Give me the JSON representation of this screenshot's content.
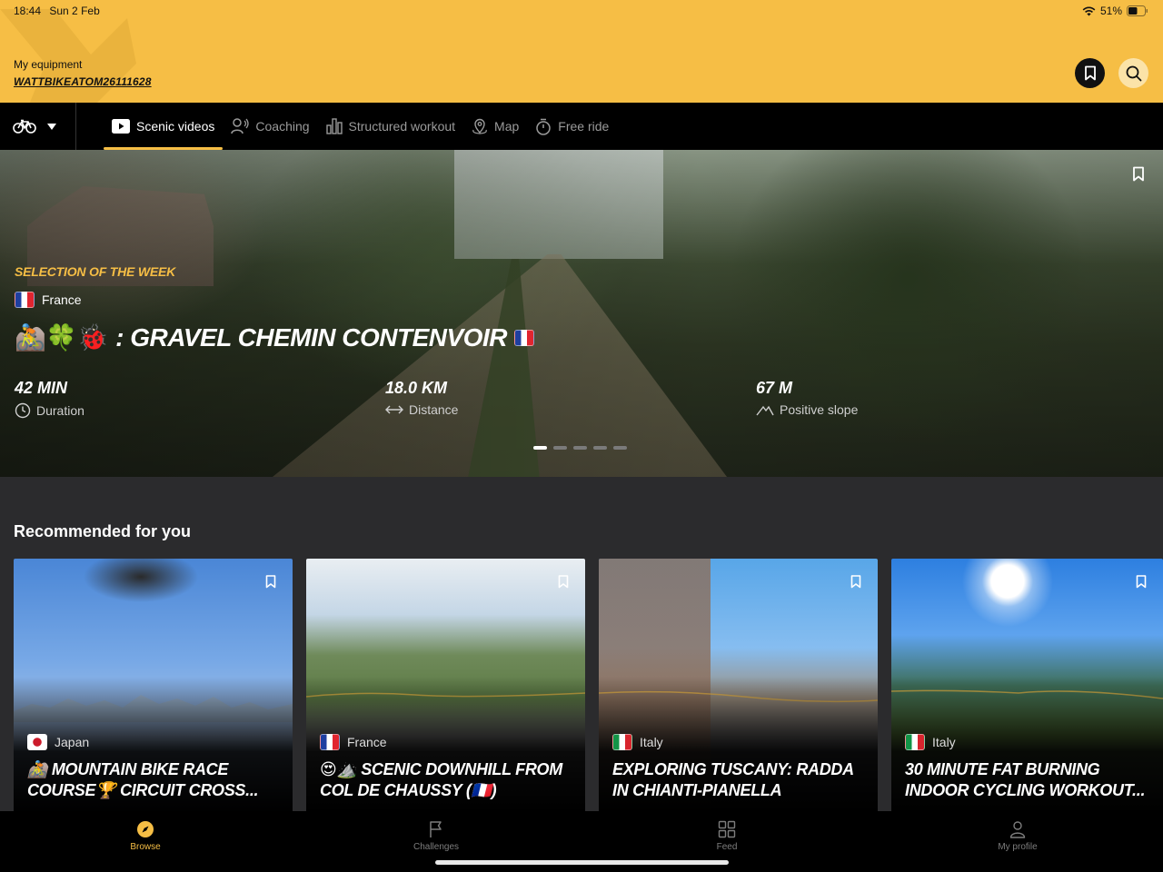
{
  "status_bar": {
    "time": "18:44",
    "date": "Sun 2 Feb",
    "battery": "51%"
  },
  "header": {
    "equipment_label": "My equipment",
    "equipment_value": "WATTBIKEATOM26111628",
    "accent_color": "#f6be45"
  },
  "tabs": [
    {
      "label": "Scenic videos",
      "icon": "play-icon",
      "active": true
    },
    {
      "label": "Coaching",
      "icon": "coach-icon",
      "active": false
    },
    {
      "label": "Structured workout",
      "icon": "bar-chart-icon",
      "active": false
    },
    {
      "label": "Map",
      "icon": "map-pin-icon",
      "active": false
    },
    {
      "label": "Free ride",
      "icon": "stopwatch-icon",
      "active": false
    }
  ],
  "hero": {
    "badge": "SELECTION OF THE WEEK",
    "country": "France",
    "title_emoji": "🚵🍀🐞",
    "title": ": GRAVEL CHEMIN CONTENVOIR",
    "stats": [
      {
        "value": "42 MIN",
        "label": "Duration",
        "icon": "clock-icon"
      },
      {
        "value": "18.0 KM",
        "label": "Distance",
        "icon": "arrows-horizontal-icon"
      },
      {
        "value": "67 M",
        "label": "Positive slope",
        "icon": "mountain-icon"
      }
    ],
    "carousel_active_index": 0,
    "carousel_count": 5
  },
  "recommended": {
    "title": "Recommended for you",
    "cards": [
      {
        "country": "Japan",
        "title": "🚵 MOUNTAIN BIKE RACE COURSE🏆 CIRCUIT CROSS..."
      },
      {
        "country": "France",
        "title": "😍⛰️ SCENIC DOWNHILL FROM COL DE CHAUSSY (🇫🇷)"
      },
      {
        "country": "Italy",
        "title": "EXPLORING TUSCANY: RADDA IN CHIANTI-PIANELLA"
      },
      {
        "country": "Italy",
        "title": "30 MINUTE FAT BURNING INDOOR CYCLING WORKOUT..."
      }
    ]
  },
  "bottom_nav": [
    {
      "label": "Browse",
      "icon": "compass-icon",
      "active": true
    },
    {
      "label": "Challenges",
      "icon": "flag-icon",
      "active": false
    },
    {
      "label": "Feed",
      "icon": "grid-icon",
      "active": false
    },
    {
      "label": "My profile",
      "icon": "user-icon",
      "active": false
    }
  ]
}
